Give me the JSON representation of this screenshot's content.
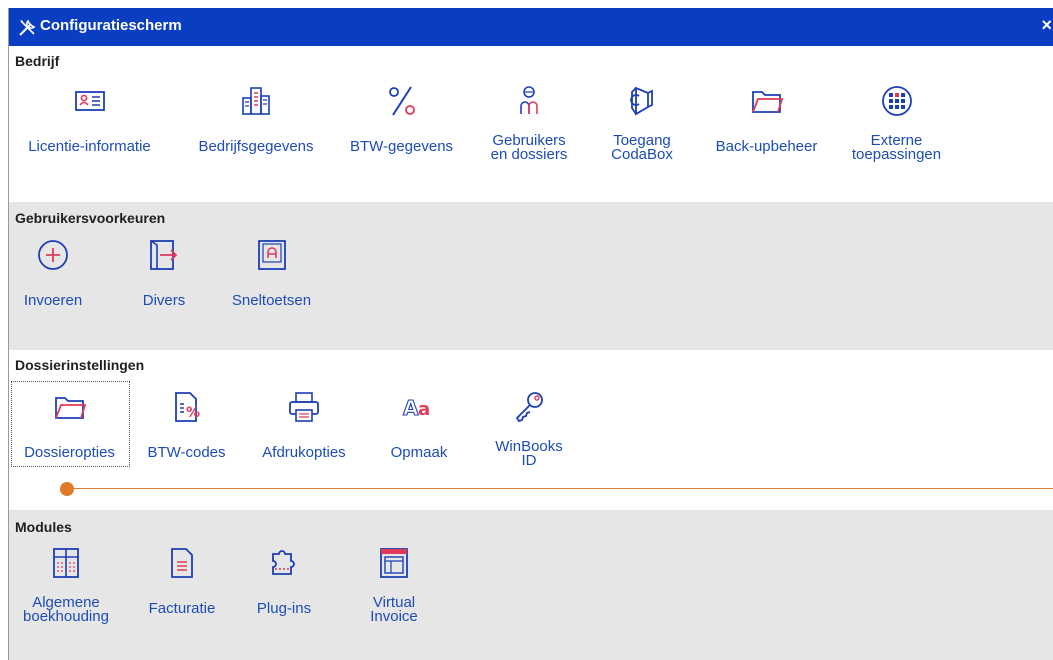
{
  "window": {
    "title": "Configuratiescherm",
    "close_label": "×"
  },
  "sections": {
    "bedrijf": {
      "title": "Bedrijf",
      "items": [
        {
          "label": "Licentie-informatie",
          "icon": "id-card-icon"
        },
        {
          "label": "Bedrijfsgegevens",
          "icon": "building-icon"
        },
        {
          "label": "BTW-gegevens",
          "icon": "percent-icon"
        },
        {
          "label1": "Gebruikers",
          "label2": "en dossiers",
          "icon": "users-icon"
        },
        {
          "label1": "Toegang",
          "label2": "CodaBox",
          "icon": "codabox-icon"
        },
        {
          "label": "Back-upbeheer",
          "icon": "folder-icon"
        },
        {
          "label1": "Externe",
          "label2": "toepassingen",
          "icon": "grid-circle-icon"
        }
      ]
    },
    "gebruikersvoorkeuren": {
      "title": "Gebruikersvoorkeuren",
      "items": [
        {
          "label": "Invoeren",
          "icon": "plus-circle-icon"
        },
        {
          "label": "Divers",
          "icon": "door-arrow-icon"
        },
        {
          "label": "Sneltoetsen",
          "icon": "keyboard-key-icon"
        }
      ]
    },
    "dossierinstellingen": {
      "title": "Dossierinstellingen",
      "items": [
        {
          "label": "Dossieropties",
          "icon": "folder-icon"
        },
        {
          "label": "BTW-codes",
          "icon": "document-percent-icon"
        },
        {
          "label": "Afdrukopties",
          "icon": "printer-icon"
        },
        {
          "label": "Opmaak",
          "icon": "font-icon"
        },
        {
          "label1": "WinBooks",
          "label2": "ID",
          "icon": "key-icon"
        }
      ]
    },
    "modules": {
      "title": "Modules",
      "items": [
        {
          "label1": "Algemene",
          "label2": "boekhouding",
          "icon": "ledger-icon"
        },
        {
          "label": "Facturatie",
          "icon": "invoice-icon"
        },
        {
          "label": "Plug-ins",
          "icon": "puzzle-icon"
        },
        {
          "label1": "Virtual",
          "label2": "Invoice",
          "icon": "virtual-invoice-icon"
        }
      ]
    }
  },
  "colors": {
    "titlebar": "#0a3ec2",
    "icon_blue": "#1c3fb5",
    "icon_red": "#e03a5a",
    "label_blue": "#1c4cb8",
    "section_gray": "#e6e6e6",
    "divider_orange": "#e07b2a"
  }
}
